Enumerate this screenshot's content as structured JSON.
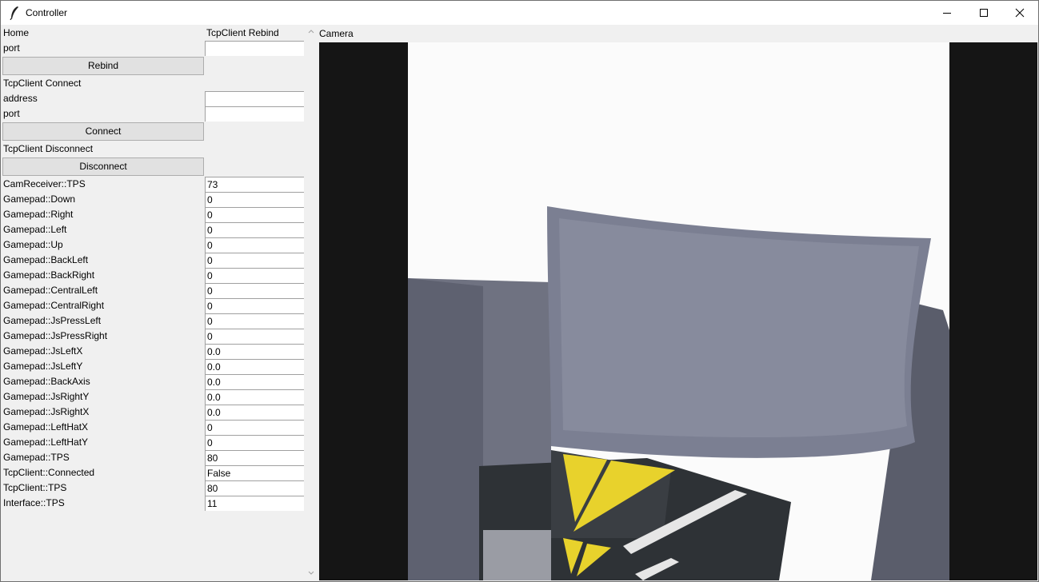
{
  "window": {
    "title": "Controller"
  },
  "rebind": {
    "section_home": "Home",
    "section_title": "TcpClient Rebind",
    "port_label": "port",
    "port_value": "",
    "button": "Rebind"
  },
  "connect": {
    "section_title": "TcpClient Connect",
    "address_label": "address",
    "address_value": "",
    "port_label": "port",
    "port_value": "",
    "button": "Connect"
  },
  "disconnect": {
    "section_title": "TcpClient Disconnect",
    "button": "Disconnect"
  },
  "stats": [
    {
      "label": "CamReceiver::TPS",
      "value": "73"
    },
    {
      "label": "Gamepad::Down",
      "value": "0"
    },
    {
      "label": "Gamepad::Right",
      "value": "0"
    },
    {
      "label": "Gamepad::Left",
      "value": "0"
    },
    {
      "label": "Gamepad::Up",
      "value": "0"
    },
    {
      "label": "Gamepad::BackLeft",
      "value": "0"
    },
    {
      "label": "Gamepad::BackRight",
      "value": "0"
    },
    {
      "label": "Gamepad::CentralLeft",
      "value": "0"
    },
    {
      "label": "Gamepad::CentralRight",
      "value": "0"
    },
    {
      "label": "Gamepad::JsPressLeft",
      "value": "0"
    },
    {
      "label": "Gamepad::JsPressRight",
      "value": "0"
    },
    {
      "label": "Gamepad::JsLeftX",
      "value": "0.0"
    },
    {
      "label": "Gamepad::JsLeftY",
      "value": "0.0"
    },
    {
      "label": "Gamepad::BackAxis",
      "value": "0.0"
    },
    {
      "label": "Gamepad::JsRightY",
      "value": "0.0"
    },
    {
      "label": "Gamepad::JsRightX",
      "value": "0.0"
    },
    {
      "label": "Gamepad::LeftHatX",
      "value": "0"
    },
    {
      "label": "Gamepad::LeftHatY",
      "value": "0"
    },
    {
      "label": "Gamepad::TPS",
      "value": "80"
    },
    {
      "label": "TcpClient::Connected",
      "value": "False"
    },
    {
      "label": "TcpClient::TPS",
      "value": "80"
    },
    {
      "label": "Interface::TPS",
      "value": "11"
    }
  ],
  "camera": {
    "label": "Camera"
  },
  "icons": {
    "app": "feather-icon",
    "minimize": "minimize-icon",
    "maximize": "maximize-icon",
    "close": "close-icon",
    "scroll_up": "chevron-up-icon",
    "scroll_down": "chevron-down-icon"
  }
}
